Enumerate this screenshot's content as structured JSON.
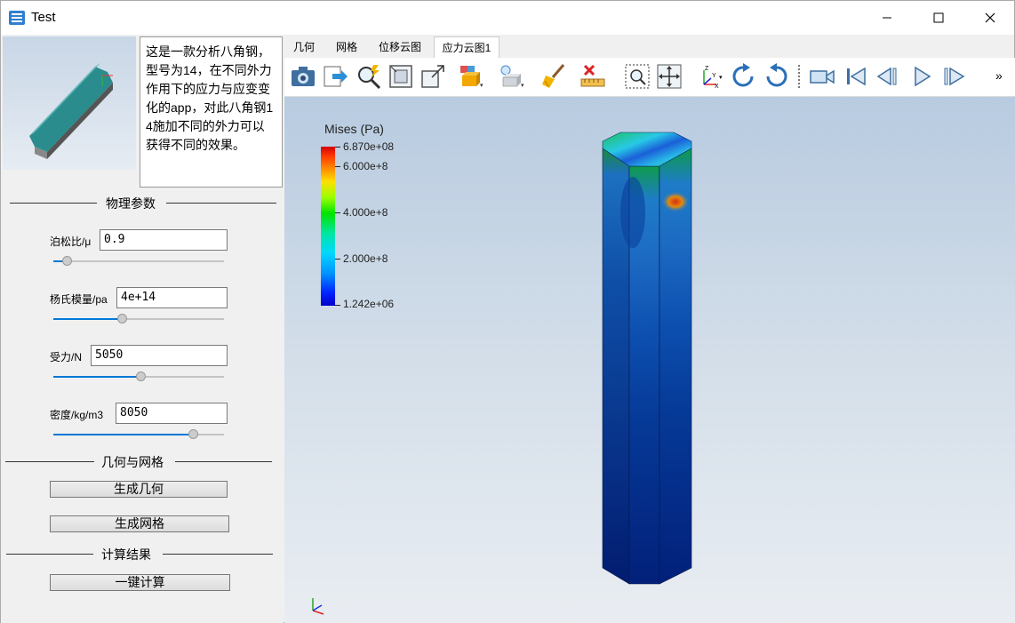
{
  "window": {
    "title": "Test"
  },
  "description": "这是一款分析八角钢，型号为14，在不同外力作用下的应力与应变变化的app，对此八角钢14施加不同的外力可以获得不同的效果。",
  "physics": {
    "section_label": "物理参数",
    "params": [
      {
        "label": "泊松比/μ",
        "value": "0.9",
        "slider_fraction": 0.08
      },
      {
        "label": "杨氏模量/pa",
        "value": "4e+14",
        "slider_fraction": 0.4
      },
      {
        "label": "受力/N",
        "value": "5050",
        "slider_fraction": 0.51
      },
      {
        "label": "密度/kg/m3",
        "value": "8050",
        "slider_fraction": 0.82
      }
    ]
  },
  "geometry": {
    "section_label": "几何与网格",
    "gen_geometry_label": "生成几何",
    "gen_mesh_label": "生成网格"
  },
  "results": {
    "section_label": "计算结果",
    "compute_label": "一键计算"
  },
  "tabs": [
    "几何",
    "网格",
    "位移云图",
    "应力云图1"
  ],
  "active_tab": "应力云图1",
  "toolbar": {
    "icons": [
      "camera-icon",
      "export-icon",
      "zoom-icon",
      "fit-view-icon",
      "scale-icon",
      "display-icon",
      "light-icon",
      "clear-icon",
      "ruler-icon",
      "box-zoom-icon",
      "pan-icon",
      "axes-icon",
      "rotate-cw-icon",
      "rotate-ccw-icon",
      "video-icon",
      "first-frame-icon",
      "prev-frame-icon",
      "play-icon",
      "next-frame-icon"
    ],
    "more": "»"
  },
  "legend": {
    "title": "Mises (Pa)",
    "ticks": [
      "6.870e+08",
      "6.000e+8",
      "4.000e+8",
      "2.000e+8",
      "1.242e+06"
    ],
    "tick_values": [
      687000000,
      600000000,
      400000000,
      200000000,
      1242000
    ],
    "min": 1242000,
    "max": 687000000
  }
}
